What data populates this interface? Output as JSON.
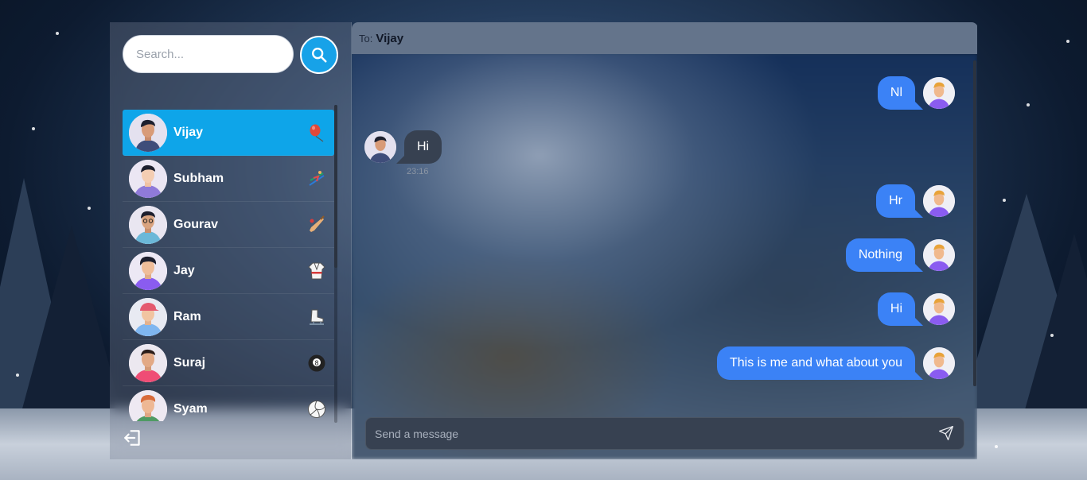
{
  "search": {
    "placeholder": "Search..."
  },
  "contacts": [
    {
      "name": "Vijay",
      "hobby_icon": "balloon-icon",
      "active": true
    },
    {
      "name": "Subham",
      "hobby_icon": "skier-icon",
      "active": false
    },
    {
      "name": "Gourav",
      "hobby_icon": "cricket-bat-icon",
      "active": false
    },
    {
      "name": "Jay",
      "hobby_icon": "martial-arts-uniform-icon",
      "active": false
    },
    {
      "name": "Ram",
      "hobby_icon": "ice-skate-icon",
      "active": false
    },
    {
      "name": "Suraj",
      "hobby_icon": "pool-8-ball-icon",
      "active": false
    },
    {
      "name": "Syam",
      "hobby_icon": "volleyball-icon",
      "active": false
    }
  ],
  "chat": {
    "to_label": "To:",
    "recipient": "Vijay",
    "messages": [
      {
        "direction": "sent",
        "text": "Nl"
      },
      {
        "direction": "received",
        "text": "Hi",
        "time": "23:16"
      },
      {
        "direction": "sent",
        "text": "Hr"
      },
      {
        "direction": "sent",
        "text": "Nothing"
      },
      {
        "direction": "sent",
        "text": "Hi"
      },
      {
        "direction": "sent",
        "text": "This is me and what about you"
      }
    ],
    "composer_placeholder": "Send a message"
  },
  "colors": {
    "active_contact": "#0ea5e9",
    "search_button": "#17a2e8",
    "sent_bubble": "#3b82f6",
    "received_bubble": "#374151",
    "chat_header": "#64748b"
  }
}
